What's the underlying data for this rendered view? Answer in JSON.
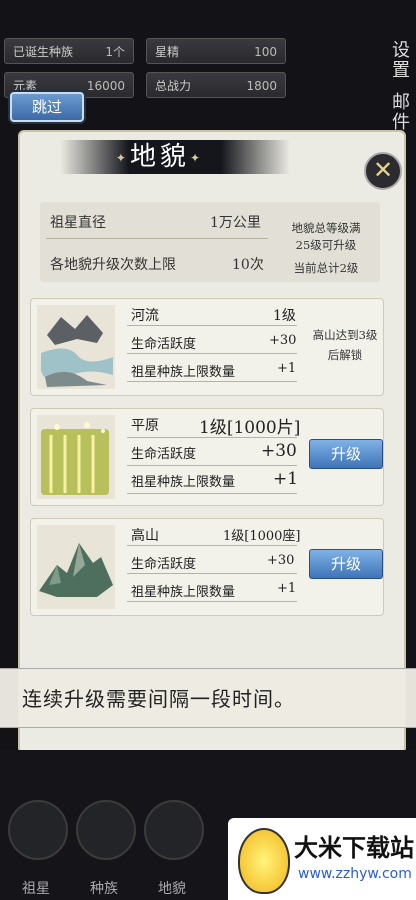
{
  "topbar": {
    "stats": [
      {
        "label": "已诞生种族",
        "value": "1个"
      },
      {
        "label": "星精",
        "value": "100"
      },
      {
        "label": "元素",
        "value": "16000"
      },
      {
        "label": "总战力",
        "value": "1800"
      }
    ],
    "settings_label": "设置",
    "mail_label": "邮件"
  },
  "skip_label": "跳过",
  "panel": {
    "title": "地貌",
    "info": {
      "diameter_label": "祖星直径",
      "diameter_value": "1万公里",
      "upgrade_limit_label": "各地貌升级次数上限",
      "upgrade_limit_value": "10次",
      "note_line1": "地貌总等级满",
      "note_line2": "25级可升级",
      "note_line3": "当前总计2级"
    },
    "cards": [
      {
        "name": "河流",
        "level": "1级",
        "stat1_label": "生命活跃度",
        "stat1_value": "+30",
        "stat2_label": "祖星种族上限数量",
        "stat2_value": "+1",
        "lock_line1": "高山达到3级",
        "lock_line2": "后解锁"
      },
      {
        "name": "平原",
        "level": "1级[1000片]",
        "stat1_label": "生命活跃度",
        "stat1_value": "+30",
        "stat2_label": "祖星种族上限数量",
        "stat2_value": "+1",
        "button": "升级"
      },
      {
        "name": "高山",
        "level": "1级[1000座]",
        "stat1_label": "生命活跃度",
        "stat1_value": "+30",
        "stat2_label": "祖星种族上限数量",
        "stat2_value": "+1",
        "button": "升级"
      }
    ]
  },
  "toast": "连续升级需要间隔一段时间。",
  "nav": {
    "items": [
      "祖星",
      "种族",
      "地貌"
    ]
  },
  "watermark": {
    "title": "大米下载站",
    "url": "www.zzhyw.com"
  }
}
